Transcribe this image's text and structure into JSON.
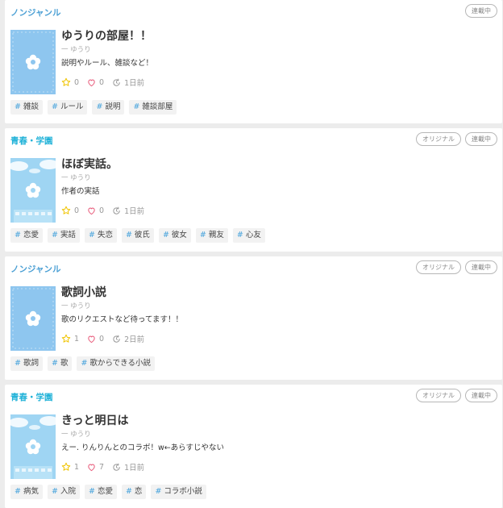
{
  "colors": {
    "genre_nonfiction": "#4a9fd4",
    "genre_youth": "#20b2d8",
    "star": "#f0c400",
    "heart": "#e85a7a",
    "tag_hash": "#47a3dc",
    "cover_plain": "#8ec6ef",
    "cover_sky": "#9fd5f3"
  },
  "stories": [
    {
      "genre": "ノンジャンル",
      "genre_color": "#4a9fd4",
      "badges": [
        "連載中"
      ],
      "cover": "plain",
      "title": "ゆうりの部屋！！",
      "author": "一 ゆうり",
      "description": "説明やルール、雑談など！",
      "stars": "0",
      "likes": "0",
      "updated": "1日前",
      "tags": [
        "雑談",
        "ルール",
        "説明",
        "雑談部屋"
      ]
    },
    {
      "genre": "青春・学園",
      "genre_color": "#20b2d8",
      "badges": [
        "オリジナル",
        "連載中"
      ],
      "cover": "sky",
      "title": "ほぼ実話。",
      "author": "一 ゆうり",
      "description": "作者の実話",
      "stars": "0",
      "likes": "0",
      "updated": "1日前",
      "tags": [
        "恋愛",
        "実話",
        "失恋",
        "彼氏",
        "彼女",
        "親友",
        "心友"
      ]
    },
    {
      "genre": "ノンジャンル",
      "genre_color": "#4a9fd4",
      "badges": [
        "オリジナル",
        "連載中"
      ],
      "cover": "plain",
      "title": "歌詞小説",
      "author": "一 ゆうり",
      "description": "歌のリクエストなど待ってます！！",
      "stars": "1",
      "likes": "0",
      "updated": "2日前",
      "tags": [
        "歌詞",
        "歌",
        "歌からできる小説"
      ]
    },
    {
      "genre": "青春・学園",
      "genre_color": "#20b2d8",
      "badges": [
        "オリジナル",
        "連載中"
      ],
      "cover": "sky",
      "title": "きっと明日は",
      "author": "一 ゆうり",
      "description": "えー. りんりんとのコラボ！w←あらすじやない",
      "stars": "1",
      "likes": "7",
      "updated": "1日前",
      "tags": [
        "病気",
        "入院",
        "恋愛",
        "恋",
        "コラボ小説"
      ]
    }
  ]
}
